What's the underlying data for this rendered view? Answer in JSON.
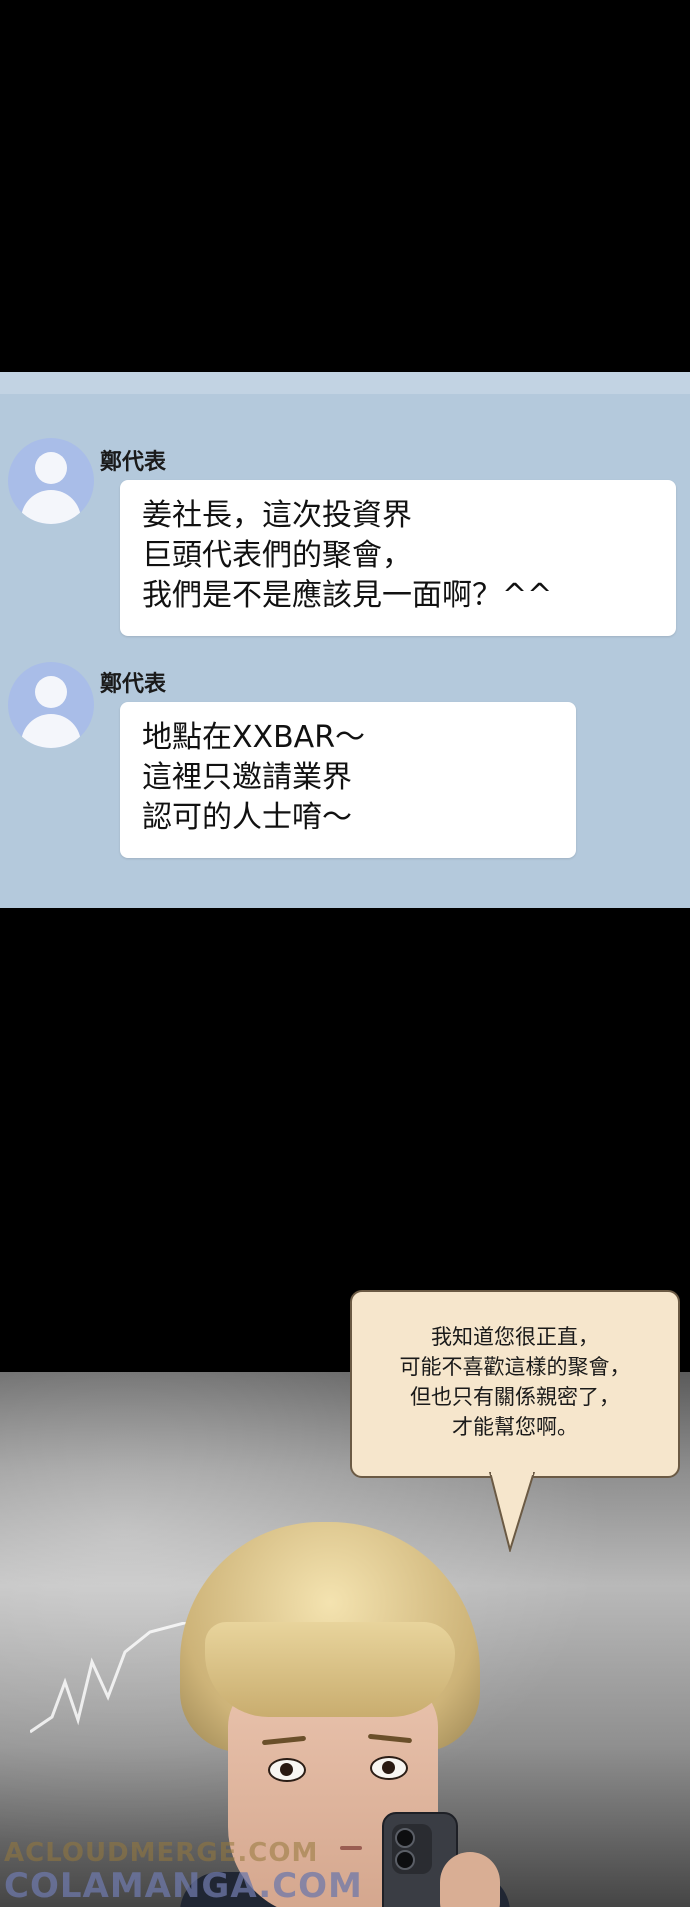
{
  "chat": {
    "messages": [
      {
        "sender": "鄭代表",
        "lines": [
          "姜社長，這次投資界",
          "巨頭代表們的聚會，",
          "我們是不是應該見一面啊？^^"
        ]
      },
      {
        "sender": "鄭代表",
        "lines": [
          "地點在XXBAR～",
          "這裡只邀請業界",
          "認可的人士唷～"
        ]
      }
    ]
  },
  "speech_bubble": {
    "lines": [
      "我知道您很正直，",
      "可能不喜歡這樣的聚會，",
      "但也只有關係親密了，",
      "才能幫您啊。"
    ]
  },
  "watermarks": {
    "line1": "ACLOUDMERGE.COM",
    "line2": "COLAMANGA.COM"
  },
  "colors": {
    "chat_background": "#b4c9dc",
    "bubble_background": "#ffffff",
    "avatar": "#a9bde8",
    "speech_bubble": "#f6e6cc"
  }
}
